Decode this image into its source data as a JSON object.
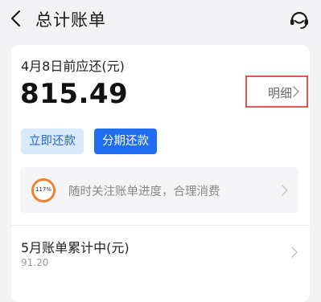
{
  "header": {
    "back_icon": "chevron-left-icon",
    "title": "总计账单",
    "service_icon": "customer-service-headset-icon"
  },
  "bill": {
    "due_label": "4月8日前应还(元)",
    "amount": "815.49",
    "detail_label": "明细",
    "highlight_color": "#e5564f"
  },
  "actions": {
    "repay_label": "立即还款",
    "installment_label": "分期还款",
    "accent_color": "#1f6ef2"
  },
  "progress": {
    "percent_label": "117%",
    "progress_fraction": 1.0,
    "ring_color": "#f0812e",
    "message": "随时关注账单进度，合理消费"
  },
  "month_summary": {
    "label": "5月账单累计中(元)",
    "amount": "91.20"
  }
}
